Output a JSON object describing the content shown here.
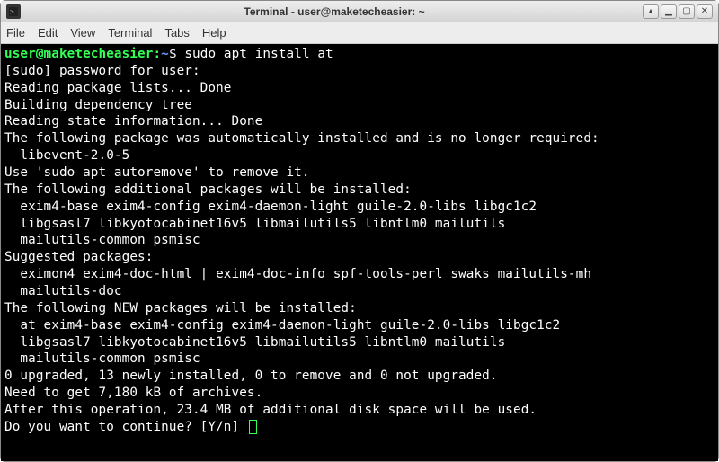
{
  "window": {
    "title": "Terminal - user@maketecheasier: ~"
  },
  "menubar": {
    "items": [
      "File",
      "Edit",
      "View",
      "Terminal",
      "Tabs",
      "Help"
    ]
  },
  "prompt": {
    "user_host": "user@maketecheasier",
    "path": "~",
    "separator": ":",
    "sigil": "$",
    "command": "sudo apt install at"
  },
  "output": {
    "lines": [
      "[sudo] password for user:",
      "Reading package lists... Done",
      "Building dependency tree",
      "Reading state information... Done",
      "The following package was automatically installed and is no longer required:",
      "  libevent-2.0-5",
      "Use 'sudo apt autoremove' to remove it.",
      "The following additional packages will be installed:",
      "  exim4-base exim4-config exim4-daemon-light guile-2.0-libs libgc1c2",
      "  libgsasl7 libkyotocabinet16v5 libmailutils5 libntlm0 mailutils",
      "  mailutils-common psmisc",
      "Suggested packages:",
      "  eximon4 exim4-doc-html | exim4-doc-info spf-tools-perl swaks mailutils-mh",
      "  mailutils-doc",
      "The following NEW packages will be installed:",
      "  at exim4-base exim4-config exim4-daemon-light guile-2.0-libs libgc1c2",
      "  libgsasl7 libkyotocabinet16v5 libmailutils5 libntlm0 mailutils",
      "  mailutils-common psmisc",
      "0 upgraded, 13 newly installed, 0 to remove and 0 not upgraded.",
      "Need to get 7,180 kB of archives.",
      "After this operation, 23.4 MB of additional disk space will be used.",
      "Do you want to continue? [Y/n] "
    ]
  }
}
